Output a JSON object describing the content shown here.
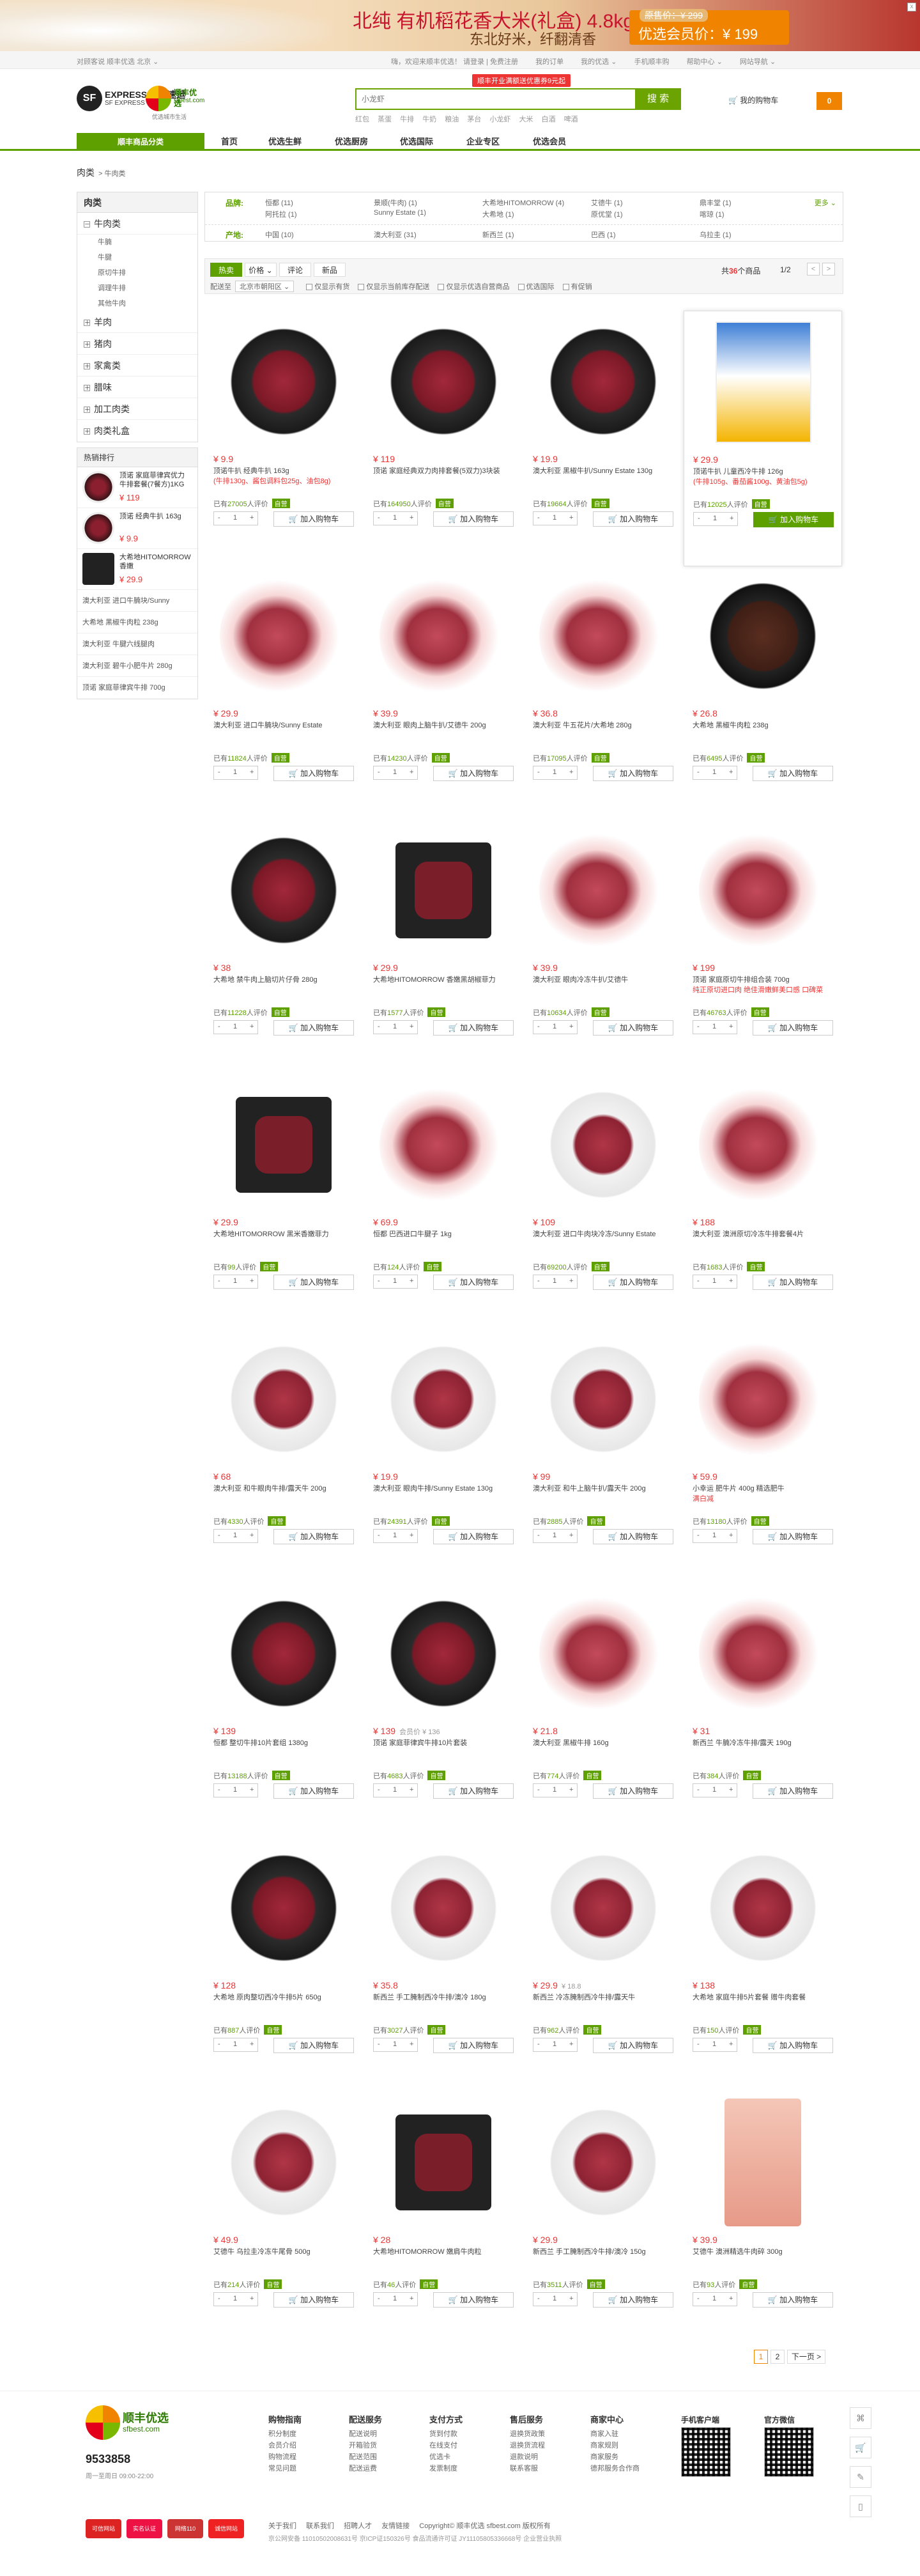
{
  "banner": {
    "title": "北纯 有机稻花香大米(礼盒) 4.8kg",
    "sub": "东北好米，纤翻清香",
    "orig": "原售价：¥ 299",
    "sale": "优选会员价：¥ 199",
    "close": "x"
  },
  "topbar": {
    "left": "对顾客说  顺丰优选  北京  ⌄",
    "links": [
      "嗨，欢迎来顺丰优选！  请登录 | 免费注册",
      "我的订单",
      "我的优选 ⌄",
      "  手机顺丰购",
      "帮助中心 ⌄",
      "网站导航 ⌄"
    ]
  },
  "logo": {
    "sf": "SF",
    "sf_name": "EXPRESS 顺丰速运",
    "sf_sub": "SF EXPRESS",
    "best": "顺丰优选",
    "best_en": "sfbest.com",
    "slogan": "优选城市生活"
  },
  "search": {
    "promo": "顺丰开业满额送优惠券9元起",
    "placeholder": "小龙虾",
    "button": "搜 索",
    "hot": [
      "红包",
      "蒸蛋",
      "牛排",
      "牛奶",
      "粮油",
      "茅台",
      "小龙虾",
      "大米",
      "白酒",
      "啤酒"
    ]
  },
  "cart": {
    "label": "我的购物车",
    "count": "0"
  },
  "nav": {
    "all": "顺丰商品分类",
    "items": [
      "首页",
      "优选生鲜",
      "优选厨房",
      "优选国际",
      "企业专区",
      "优选会员"
    ]
  },
  "crumb": {
    "root": "肉类",
    "current": "> 牛肉类"
  },
  "side": {
    "title": "肉类",
    "cats": [
      {
        "name": "牛肉类",
        "open": "－",
        "subs": [
          "牛腩",
          "牛腱",
          "原切牛排",
          "调理牛排",
          "其他牛肉"
        ]
      },
      {
        "name": "羊肉",
        "open": "＋",
        "subs": []
      },
      {
        "name": "猪肉",
        "open": "＋",
        "subs": []
      },
      {
        "name": "家禽类",
        "open": "＋",
        "subs": []
      },
      {
        "name": "腊味",
        "open": "＋",
        "subs": []
      },
      {
        "name": "加工肉类",
        "open": "＋",
        "subs": []
      },
      {
        "name": "肉类礼盒",
        "open": "＋",
        "subs": []
      }
    ],
    "hot_title": "热销排行",
    "hot_items": [
      {
        "name": "顶诺 家庭菲律宾优力牛排套餐(7餐方)1KG",
        "price": "¥ 119"
      },
      {
        "name": "顶诺 经典牛扒 163g",
        "price": "¥ 9.9"
      },
      {
        "name": "大希地HITOMORROW 香嫩",
        "price": "¥ 29.9"
      }
    ],
    "hot_text": [
      "澳大利亚 进口牛腩块/Sunny",
      "大希地 黑椒牛肉粒 238g",
      "澳大利亚 牛腱六线腿肉",
      "澳大利亚 碧牛小肥牛片 280g",
      "顶诺 家庭菲律宾牛排 700g"
    ]
  },
  "filter": {
    "brand_label": "品牌:",
    "brands": [
      "恒都 (11)",
      "景顺(牛肉) (1)",
      "大希地HITOMORROW (4)",
      "艾德牛 (1)",
      "鼎丰堂 (1)",
      "阿托拉 (1)",
      "Sunny Estate (1)",
      "大希地 (1)",
      "原优堂 (1)",
      "喀琼 (1)"
    ],
    "more": "更多 ⌄",
    "origin_label": "产地:",
    "origins": [
      "中国 (10)",
      "澳大利亚 (31)",
      "新西兰 (1)",
      "巴西 (1)",
      "乌拉圭 (1)"
    ]
  },
  "sort": {
    "tabs": [
      "热卖",
      "价格 ⌄",
      "评论",
      "新品"
    ],
    "count_pre": "共",
    "count": "36",
    "count_post": "个商品",
    "page": "1/2",
    "prev": "<",
    "next": ">",
    "deliver": "配送至",
    "region": "北京市朝阳区 ⌄",
    "checks": [
      "仅显示有货",
      "仅显示当前库存配送",
      "仅显示优选自营商品",
      "优选国际",
      "有促销"
    ]
  },
  "products": [
    {
      "price": "¥ 9.9",
      "name": "顶诺牛扒 经典牛扒 163g",
      "sub": "(牛排130g、酱包调料包25g、油包8g)",
      "rev": "27005",
      "img": "plate",
      "btn": "加入购物车"
    },
    {
      "price": "¥ 119",
      "name": "顶诺 家庭经典双力肉排套餐(5双力)3块装",
      "sub": "",
      "rev": "164950",
      "img": "plate",
      "btn": "加入购物车"
    },
    {
      "price": "¥ 19.9",
      "name": "澳大利亚 黑椒牛扒/Sunny Estate 130g",
      "sub": "",
      "rev": "19664",
      "img": "plate",
      "btn": "加入购物车"
    },
    {
      "price": "¥ 29.9",
      "name": "顶诺牛扒 儿童西冷牛排 126g",
      "sub": "(牛排105g、番茄酱100g、黄油包5g)",
      "rev": "12025",
      "img": "pack",
      "btn": "加入购物车"
    },
    {
      "price": "¥ 29.9",
      "name": "澳大利亚 进口牛腩块/Sunny Estate",
      "sub": "",
      "rev": "11824",
      "img": "raw",
      "btn": "加入购物车"
    },
    {
      "price": "¥ 39.9",
      "name": "澳大利亚 眼肉上脑牛扒/艾德牛 200g",
      "sub": "",
      "rev": "14230",
      "img": "raw",
      "btn": "加入购物车"
    },
    {
      "price": "¥ 36.8",
      "name": "澳大利亚 牛五花片/大希地 280g",
      "sub": "",
      "rev": "17095",
      "img": "raw",
      "btn": "加入购物车"
    },
    {
      "price": "¥ 26.8",
      "name": "大希地 黑椒牛肉粒 238g",
      "sub": "",
      "rev": "6495",
      "img": "dark",
      "btn": "加入购物车"
    },
    {
      "price": "¥ 38",
      "name": "大希地 禁牛肉上脑切片仔骨 280g",
      "sub": "",
      "rev": "11228",
      "img": "plate",
      "btn": "加入购物车"
    },
    {
      "price": "¥ 29.9",
      "name": "大希地HITOMORROW 香嫩黑胡椒菲力",
      "sub": "",
      "rev": "1577",
      "img": "box",
      "btn": "加入购物车"
    },
    {
      "price": "¥ 39.9",
      "name": "澳大利亚 眼肉冷冻牛扒/艾德牛",
      "sub": "",
      "rev": "10634",
      "img": "raw",
      "btn": "加入购物车"
    },
    {
      "price": "¥ 199",
      "name": "顶诺 家庭原切牛排组合装 700g",
      "sub": "纯正原切进口肉 绝佳滑嫩鲜美口感 口碑菜",
      "rev": "46763",
      "img": "raw",
      "btn": "加入购物车"
    },
    {
      "price": "¥ 29.9",
      "name": "大希地HITOMORROW 黑米香嫩菲力",
      "sub": "",
      "rev": "99",
      "img": "box",
      "btn": "加入购物车"
    },
    {
      "price": "¥ 69.9",
      "name": "恒都 巴西进口牛腱子 1kg",
      "sub": "",
      "rev": "124",
      "img": "raw",
      "btn": "加入购物车"
    },
    {
      "price": "¥ 109",
      "name": "澳大利亚 进口牛肉块冷冻/Sunny Estate",
      "sub": "",
      "rev": "69200",
      "img": "white",
      "btn": "加入购物车"
    },
    {
      "price": "¥ 188",
      "name": "澳大利亚 澳洲原切冷冻牛排套餐4片",
      "sub": "",
      "rev": "1683",
      "img": "raw",
      "btn": "加入购物车"
    },
    {
      "price": "¥ 68",
      "name": "澳大利亚 和牛眼肉牛排/露天牛 200g",
      "sub": "",
      "rev": "4330",
      "img": "white",
      "btn": "加入购物车"
    },
    {
      "price": "¥ 19.9",
      "name": "澳大利亚 眼肉牛排/Sunny Estate 130g",
      "sub": "",
      "rev": "24391",
      "img": "white",
      "btn": "加入购物车"
    },
    {
      "price": "¥ 99",
      "name": "澳大利亚 和牛上脑牛扒/露天牛 200g",
      "sub": "",
      "rev": "2885",
      "img": "white",
      "btn": "加入购物车"
    },
    {
      "price": "¥ 59.9",
      "name": "小幸运 肥牛片 400g 精选肥牛",
      "sub": "满白减",
      "rev": "13180",
      "img": "raw",
      "btn": "加入购物车"
    },
    {
      "price": "¥ 139",
      "name": "恒都 整切牛排10片套组 1380g",
      "sub": "",
      "rev": "13188",
      "img": "plate",
      "btn": "加入购物车"
    },
    {
      "price": "¥ 139",
      "pre": "会员价 ¥ 136",
      "name": "顶诺 家庭菲律宾牛排10片套装",
      "sub": "",
      "rev": "4683",
      "img": "plate",
      "btn": "加入购物车"
    },
    {
      "price": "¥ 21.8",
      "name": "澳大利亚 黑椒牛排 160g",
      "sub": "",
      "rev": "774",
      "img": "raw",
      "btn": "加入购物车"
    },
    {
      "price": "¥ 31",
      "name": "新西兰 牛腩冷冻牛排/露天 190g",
      "sub": "",
      "rev": "384",
      "img": "raw",
      "btn": "加入购物车"
    },
    {
      "price": "¥ 128",
      "name": "大希地 原肉整切西冷牛排5片 650g",
      "sub": "",
      "rev": "887",
      "img": "plate",
      "btn": "加入购物车"
    },
    {
      "price": "¥ 35.8",
      "name": "新西兰 手工腌制西冷牛排/澳冷 180g",
      "sub": "",
      "rev": "3027",
      "img": "white",
      "btn": "加入购物车"
    },
    {
      "price": "¥ 29.9",
      "pre": "¥ 18.8",
      "name": "新西兰 冷冻腌制西冷牛排/露天牛",
      "sub": "",
      "rev": "962",
      "img": "white",
      "btn": "加入购物车"
    },
    {
      "price": "¥ 138",
      "name": "大希地 家庭牛排5片套餐 赠牛肉套餐",
      "sub": "",
      "rev": "150",
      "img": "white",
      "btn": "加入购物车"
    },
    {
      "price": "¥ 49.9",
      "name": "艾德牛 乌拉圭冷冻牛尾骨 500g",
      "sub": "",
      "rev": "214",
      "img": "white",
      "btn": "加入购物车"
    },
    {
      "price": "¥ 28",
      "name": "大希地HITOMORROW 嫩肩牛肉粒",
      "sub": "",
      "rev": "46",
      "img": "box",
      "btn": "加入购物车"
    },
    {
      "price": "¥ 29.9",
      "name": "新西兰 手工腌制西冷牛排/澳冷 150g",
      "sub": "",
      "rev": "3511",
      "img": "white",
      "btn": "加入购物车"
    },
    {
      "price": "¥ 39.9",
      "name": "艾德牛 澳洲精选牛肉碎 300g",
      "sub": "",
      "rev": "93",
      "img": "bag",
      "btn": "加入购物车"
    }
  ],
  "card_common": {
    "rev_pre": "已有",
    "rev_post": "人评价",
    "self": "自营",
    "minus": "-",
    "qty": "1",
    "plus": "+"
  },
  "pager": {
    "p1": "1",
    "p2": "2",
    "next": "下一页 >"
  },
  "footer": {
    "best": "顺丰优选",
    "best_en": "sfbest.com",
    "phone": "9533858",
    "time": "周一至周日 09:00-22:00",
    "cols": [
      {
        "h": "购物指南",
        "items": [
          "积分制度",
          "会员介绍",
          "购物流程",
          "常见问题"
        ]
      },
      {
        "h": "配送服务",
        "items": [
          "配送说明",
          "开箱验货",
          "配送范围",
          "配送运费"
        ]
      },
      {
        "h": "支付方式",
        "items": [
          "货到付款",
          "在线支付",
          "优选卡",
          "发票制度"
        ]
      },
      {
        "h": "售后服务",
        "items": [
          "退换货政策",
          "退换货流程",
          "退款说明",
          "联系客服"
        ]
      },
      {
        "h": "商家中心",
        "items": [
          "商家入驻",
          "商家规则",
          "商家服务",
          "德邦服务合作商"
        ]
      }
    ],
    "qr1": "手机客户端",
    "qr2": "官方微信",
    "badges": [
      "可信网站",
      "实名认证",
      "网络110",
      "诚信网站"
    ],
    "links": [
      "关于我们",
      "联系我们",
      "招聘人才",
      "友情链接",
      "Copyright© 顺丰优选 sfbest.com 版权所有"
    ],
    "icp": "京公网安备 11010502008631号   京ICP证150326号   食品流通许可证 JY11105805336668号   企业营业执照"
  },
  "tools": [
    "⌘",
    "🛒",
    "✎",
    "▯"
  ],
  "colors": {
    "green": "#5ea000",
    "orange": "#f08300",
    "red": "#e33"
  }
}
